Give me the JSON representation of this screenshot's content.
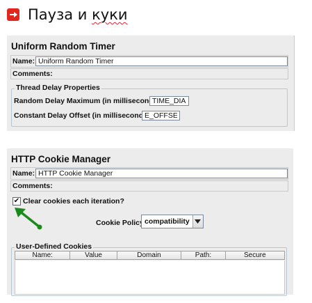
{
  "slide": {
    "title_main": "Пауза и ",
    "title_underlined": "куки",
    "bullet_icon": "arrow-right-icon",
    "accent": "#e2261d"
  },
  "timer_panel": {
    "title": "Uniform Random Timer",
    "name_label": "Name:",
    "name_value": "Uniform Random Timer",
    "comments_label": "Comments:",
    "group_title": "Thread Delay Properties",
    "max_label": "Random Delay Maximum (in milliseconds):",
    "max_value": "TIME_DIAP}",
    "offset_label": "Constant Delay Offset (in milliseconds):",
    "offset_value": "E_OFFSET}"
  },
  "cookie_panel": {
    "title": "HTTP Cookie Manager",
    "name_label": "Name:",
    "name_value": "HTTP Cookie Manager",
    "comments_label": "Comments:",
    "clear_label": "Clear cookies each iteration?",
    "clear_checked": "✔",
    "policy_label": "Cookie Policy",
    "policy_value": "compatibility",
    "group_title": "User-Defined Cookies",
    "columns": [
      "Name:",
      "Value",
      "Domain",
      "Path:",
      "Secure"
    ],
    "annotation_color": "#1a8a1a"
  }
}
